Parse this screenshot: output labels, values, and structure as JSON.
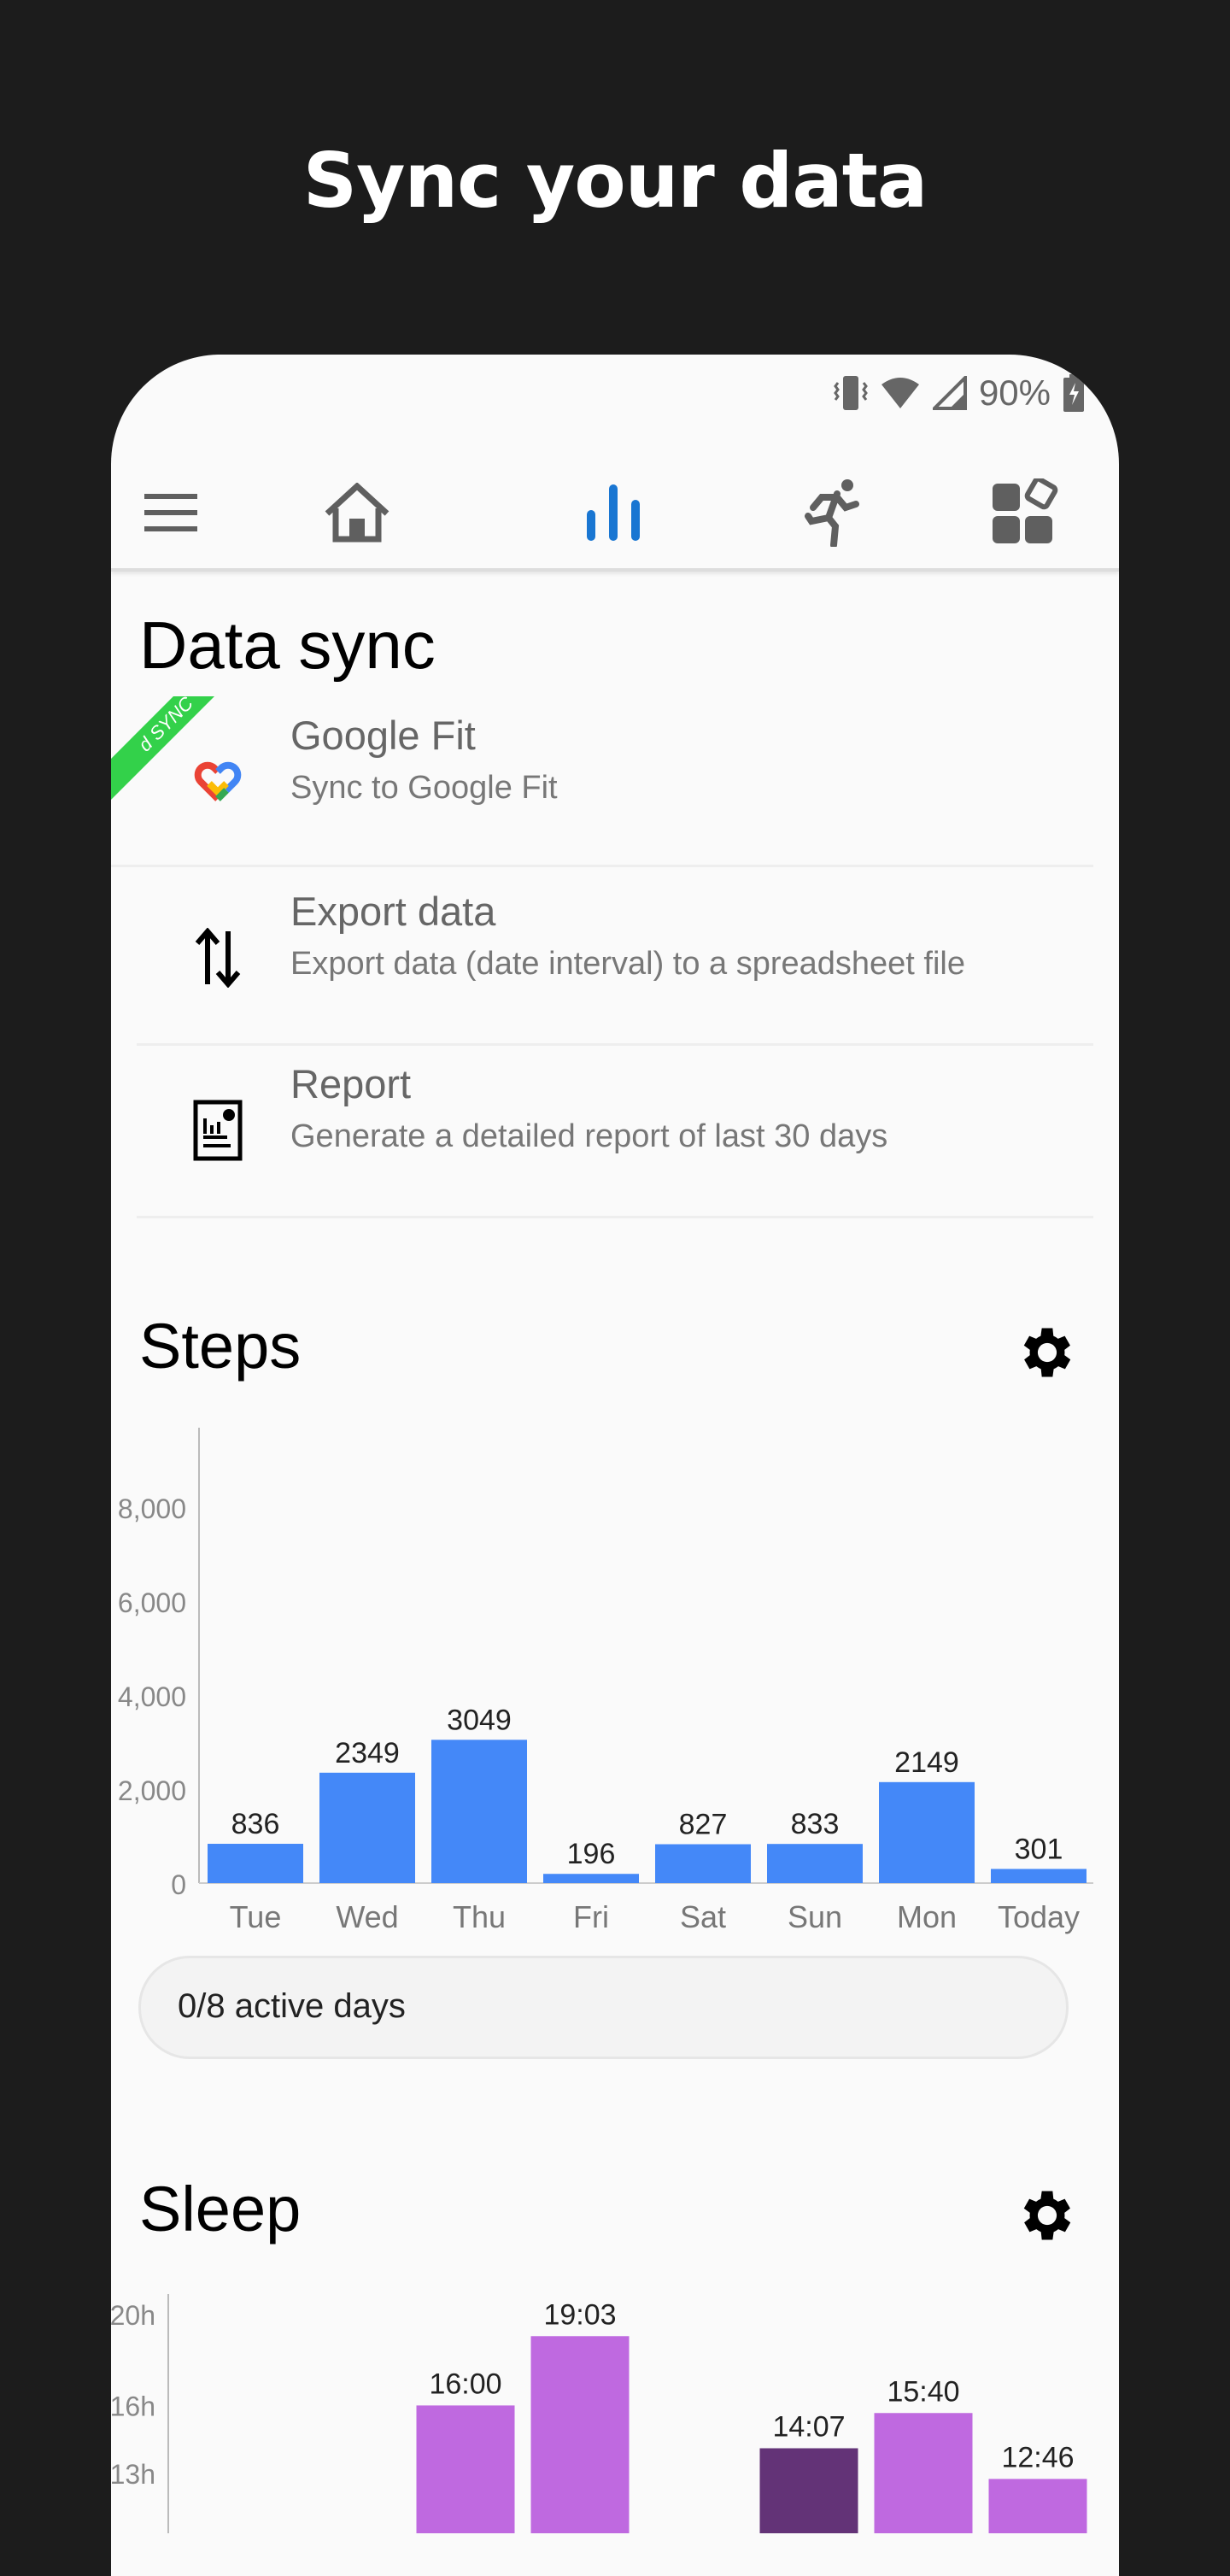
{
  "headline": "Sync your data",
  "status_bar": {
    "battery": "90%",
    "icons": [
      "vibrate-icon",
      "wifi-icon",
      "signal-icon",
      "battery-charging-icon"
    ]
  },
  "nav": {
    "items": [
      {
        "icon": "menu-icon"
      },
      {
        "icon": "home-icon"
      },
      {
        "icon": "bar-chart-icon",
        "active": true
      },
      {
        "icon": "running-icon"
      },
      {
        "icon": "widgets-icon"
      }
    ],
    "active_color": "#1976d2",
    "color": "#5f5f5f"
  },
  "data_sync": {
    "title": "Data sync",
    "ribbon": "d SYNC",
    "items": [
      {
        "icon": "google-fit-icon",
        "title": "Google Fit",
        "subtitle": "Sync to Google Fit"
      },
      {
        "icon": "export-arrows-icon",
        "title": "Export data",
        "subtitle": "Export data (date interval) to a spreadsheet file"
      },
      {
        "icon": "report-icon",
        "title": "Report",
        "subtitle": "Generate a detailed report of last 30 days"
      }
    ]
  },
  "steps": {
    "title": "Steps",
    "active_days": "0/8 active days"
  },
  "sleep": {
    "title": "Sleep"
  },
  "chart_data": [
    {
      "type": "bar",
      "categories": [
        "Tue",
        "Wed",
        "Thu",
        "Fri",
        "Sat",
        "Sun",
        "Mon",
        "Today"
      ],
      "values": [
        836,
        2349,
        3049,
        196,
        827,
        833,
        2149,
        301
      ],
      "data_labels": [
        "836",
        "2349",
        "3049",
        "196",
        "827",
        "833",
        "2149",
        "301"
      ],
      "yticks": [
        "0",
        "2,000",
        "4,000",
        "6,000",
        "8,000"
      ],
      "ytick_values": [
        0,
        2000,
        4000,
        6000,
        8000
      ],
      "color": "#4488f8",
      "ylim": [
        0,
        9500
      ]
    },
    {
      "type": "bar",
      "values_hours": [
        null,
        null,
        16.0,
        19.05,
        null,
        14.117,
        15.667,
        12.767
      ],
      "data_labels": [
        null,
        null,
        "16:00",
        "19:03",
        null,
        "14:07",
        "15:40",
        "12:46"
      ],
      "bar_colors": [
        null,
        null,
        "#bf69e0",
        "#bf69e0",
        null,
        "#633377",
        "#bf69e0",
        "#bf69e0"
      ],
      "yticks": [
        "20h",
        "16h",
        "13h"
      ],
      "ytick_values": [
        20,
        16,
        13
      ]
    }
  ]
}
